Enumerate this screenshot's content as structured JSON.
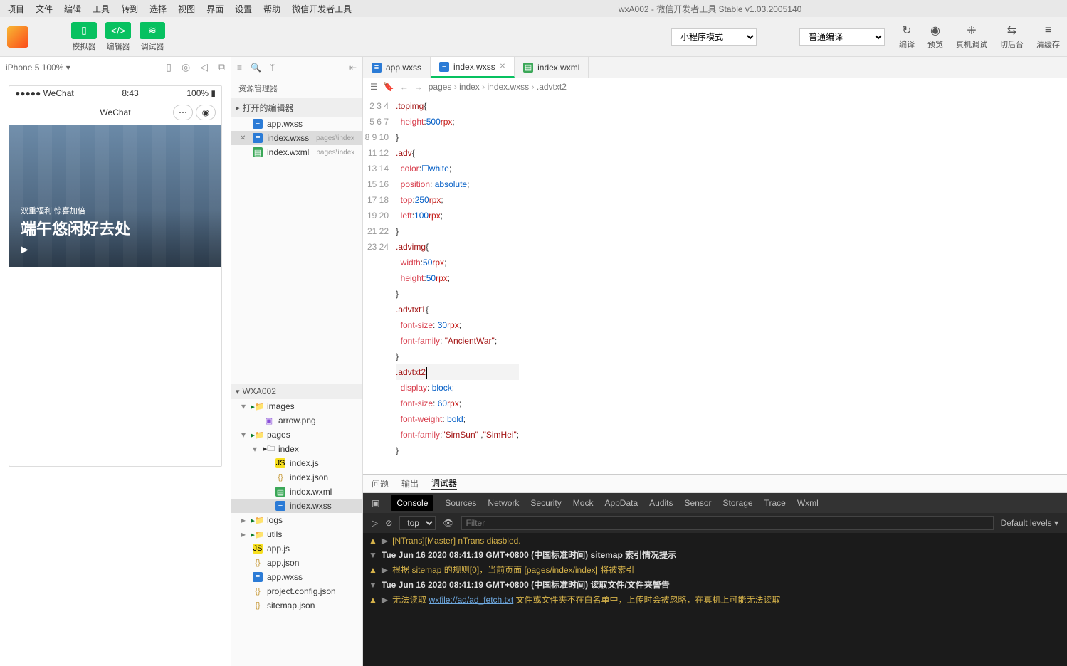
{
  "title": "wxA002 - 微信开发者工具 Stable v1.03.2005140",
  "menu": [
    "项目",
    "文件",
    "编辑",
    "工具",
    "转到",
    "选择",
    "视图",
    "界面",
    "设置",
    "帮助",
    "微信开发者工具"
  ],
  "tb": {
    "simulator": "模拟器",
    "editor": "编辑器",
    "debugger": "调试器"
  },
  "mode_select": "小程序模式",
  "compile_select": "普通编译",
  "right": {
    "compile": "编译",
    "preview": "预览",
    "remoteDebug": "真机调试",
    "cutBg": "切后台",
    "clearCache": "清缓存"
  },
  "sim": {
    "device": "iPhone 5 100% ▾",
    "carrier": "●●●●● WeChat",
    "wifi": "⚡",
    "time": "8:43",
    "battery": "100%",
    "navTitle": "WeChat"
  },
  "hero": {
    "line1": "双重福利 惊喜加倍",
    "line2": "端午悠闲好去处"
  },
  "explorer_title": "资源管理器",
  "sec_open": "打开的编辑器",
  "open_files": [
    {
      "name": "app.wxss",
      "kind": "wxss",
      "close": false
    },
    {
      "name": "index.wxss",
      "kind": "wxss",
      "hint": "pages\\index",
      "close": true,
      "sel": true
    },
    {
      "name": "index.wxml",
      "kind": "wxml",
      "hint": "pages\\index",
      "close": false
    }
  ],
  "sec_proj": "WXA002",
  "tree": [
    {
      "d": 1,
      "name": "images",
      "kind": "folder",
      "exp": true
    },
    {
      "d": 2,
      "name": "arrow.png",
      "kind": "img"
    },
    {
      "d": 1,
      "name": "pages",
      "kind": "folder",
      "exp": true
    },
    {
      "d": 2,
      "name": "index",
      "kind": "folder-g",
      "exp": true
    },
    {
      "d": 3,
      "name": "index.js",
      "kind": "js"
    },
    {
      "d": 3,
      "name": "index.json",
      "kind": "json"
    },
    {
      "d": 3,
      "name": "index.wxml",
      "kind": "wxml"
    },
    {
      "d": 3,
      "name": "index.wxss",
      "kind": "wxss",
      "sel": true
    },
    {
      "d": 1,
      "name": "logs",
      "kind": "folder",
      "exp": false
    },
    {
      "d": 1,
      "name": "utils",
      "kind": "folder",
      "exp": false
    },
    {
      "d": 1,
      "name": "app.js",
      "kind": "js"
    },
    {
      "d": 1,
      "name": "app.json",
      "kind": "json"
    },
    {
      "d": 1,
      "name": "app.wxss",
      "kind": "wxss"
    },
    {
      "d": 1,
      "name": "project.config.json",
      "kind": "json"
    },
    {
      "d": 1,
      "name": "sitemap.json",
      "kind": "json"
    }
  ],
  "tabs": [
    {
      "name": "app.wxss",
      "kind": "wxss"
    },
    {
      "name": "index.wxss",
      "kind": "wxss",
      "active": true,
      "closable": true
    },
    {
      "name": "index.wxml",
      "kind": "wxml"
    }
  ],
  "crumbs": [
    "pages",
    "index",
    "index.wxss",
    ".advtxt2"
  ],
  "code": [
    {
      "n": 2,
      "t": [
        [
          "sel",
          ".topimg"
        ],
        [
          "p",
          "{"
        ]
      ]
    },
    {
      "n": 3,
      "t": [
        [
          "sp",
          "  "
        ],
        [
          "prop",
          "height"
        ],
        [
          "p",
          ":"
        ],
        [
          "num",
          "500"
        ],
        [
          "unit",
          "rpx"
        ],
        [
          "p",
          ";"
        ]
      ]
    },
    {
      "n": 4,
      "t": [
        [
          "p",
          "}"
        ]
      ]
    },
    {
      "n": 5,
      "t": [
        [
          "sel",
          ".adv"
        ],
        [
          "p",
          "{"
        ]
      ]
    },
    {
      "n": 6,
      "t": [
        [
          "sp",
          "  "
        ],
        [
          "prop",
          "color"
        ],
        [
          "p",
          ":"
        ],
        [
          "val",
          "☐white"
        ],
        [
          "p",
          ";"
        ]
      ]
    },
    {
      "n": 7,
      "t": [
        [
          "sp",
          "  "
        ],
        [
          "prop",
          "position"
        ],
        [
          "p",
          ": "
        ],
        [
          "val",
          "absolute"
        ],
        [
          "p",
          ";"
        ]
      ]
    },
    {
      "n": 8,
      "t": [
        [
          "sp",
          "  "
        ],
        [
          "prop",
          "top"
        ],
        [
          "p",
          ":"
        ],
        [
          "num",
          "250"
        ],
        [
          "unit",
          "rpx"
        ],
        [
          "p",
          ";"
        ]
      ]
    },
    {
      "n": 9,
      "t": [
        [
          "sp",
          "  "
        ],
        [
          "prop",
          "left"
        ],
        [
          "p",
          ":"
        ],
        [
          "num",
          "100"
        ],
        [
          "unit",
          "rpx"
        ],
        [
          "p",
          ";"
        ]
      ]
    },
    {
      "n": 10,
      "t": [
        [
          "p",
          "}"
        ]
      ]
    },
    {
      "n": 11,
      "t": [
        [
          "sel",
          ".advimg"
        ],
        [
          "p",
          "{"
        ]
      ]
    },
    {
      "n": 12,
      "t": [
        [
          "sp",
          "  "
        ],
        [
          "prop",
          "width"
        ],
        [
          "p",
          ":"
        ],
        [
          "num",
          "50"
        ],
        [
          "unit",
          "rpx"
        ],
        [
          "p",
          ";"
        ]
      ]
    },
    {
      "n": 13,
      "t": [
        [
          "sp",
          "  "
        ],
        [
          "prop",
          "height"
        ],
        [
          "p",
          ":"
        ],
        [
          "num",
          "50"
        ],
        [
          "unit",
          "rpx"
        ],
        [
          "p",
          ";"
        ]
      ]
    },
    {
      "n": 14,
      "t": [
        [
          "p",
          "}"
        ]
      ]
    },
    {
      "n": 15,
      "t": [
        [
          "sel",
          ".advtxt1"
        ],
        [
          "p",
          "{"
        ]
      ]
    },
    {
      "n": 16,
      "t": [
        [
          "sp",
          "  "
        ],
        [
          "prop",
          "font-size"
        ],
        [
          "p",
          ": "
        ],
        [
          "num",
          "30"
        ],
        [
          "unit",
          "rpx"
        ],
        [
          "p",
          ";"
        ]
      ]
    },
    {
      "n": 17,
      "t": [
        [
          "sp",
          "  "
        ],
        [
          "prop",
          "font-family"
        ],
        [
          "p",
          ": "
        ],
        [
          "str",
          "\"AncientWar\""
        ],
        [
          "p",
          ";"
        ]
      ]
    },
    {
      "n": 18,
      "t": [
        [
          "p",
          "}"
        ]
      ]
    },
    {
      "n": 19,
      "t": [
        [
          "sel",
          ".advtxt2"
        ],
        [
          "caret",
          ""
        ]
      ],
      "cl": true
    },
    {
      "n": 20,
      "t": [
        [
          "sp",
          "  "
        ],
        [
          "prop",
          "display"
        ],
        [
          "p",
          ": "
        ],
        [
          "val",
          "block"
        ],
        [
          "p",
          ";"
        ]
      ]
    },
    {
      "n": 21,
      "t": [
        [
          "sp",
          "  "
        ],
        [
          "prop",
          "font-size"
        ],
        [
          "p",
          ": "
        ],
        [
          "num",
          "60"
        ],
        [
          "unit",
          "rpx"
        ],
        [
          "p",
          ";"
        ]
      ]
    },
    {
      "n": 22,
      "t": [
        [
          "sp",
          "  "
        ],
        [
          "prop",
          "font-weight"
        ],
        [
          "p",
          ": "
        ],
        [
          "val",
          "bold"
        ],
        [
          "p",
          ";"
        ]
      ]
    },
    {
      "n": 23,
      "t": [
        [
          "sp",
          "  "
        ],
        [
          "prop",
          "font-family"
        ],
        [
          "p",
          ":"
        ],
        [
          "str",
          "\"SimSun\""
        ],
        [
          "p",
          " ,"
        ],
        [
          "str",
          "\"SimHei\""
        ],
        [
          "p",
          ";"
        ]
      ]
    },
    {
      "n": 24,
      "t": [
        [
          "p",
          "}"
        ]
      ]
    }
  ],
  "btabs": [
    "问题",
    "输出",
    "调试器"
  ],
  "btab_active": "调试器",
  "devnav": [
    "Console",
    "Sources",
    "Network",
    "Security",
    "Mock",
    "AppData",
    "Audits",
    "Sensor",
    "Storage",
    "Trace",
    "Wxml"
  ],
  "devnav_active": "Console",
  "devbar": {
    "ctx": "top",
    "filter_ph": "Filter",
    "levels": "Default levels ▾"
  },
  "console_lines": [
    {
      "type": "warn",
      "caret": "▶",
      "text": "[NTrans][Master] nTrans diasbled."
    },
    {
      "type": "head",
      "caret": "▼",
      "text": "Tue Jun 16 2020 08:41:19 GMT+0800 (中国标准时间) sitemap 索引情况提示"
    },
    {
      "type": "warn",
      "caret": "▶",
      "text": "根据 sitemap 的规则[0]，当前页面 [pages/index/index] 将被索引"
    },
    {
      "type": "head",
      "caret": "▼",
      "text": "Tue Jun 16 2020 08:41:19 GMT+0800 (中国标准时间) 读取文件/文件夹警告"
    },
    {
      "type": "warn",
      "caret": "▶",
      "pre": "无法读取 ",
      "link": "wxfile://ad/ad_fetch.txt",
      "post": " 文件或文件夹不在白名单中，上传时会被忽略，在真机上可能无法读取"
    }
  ]
}
